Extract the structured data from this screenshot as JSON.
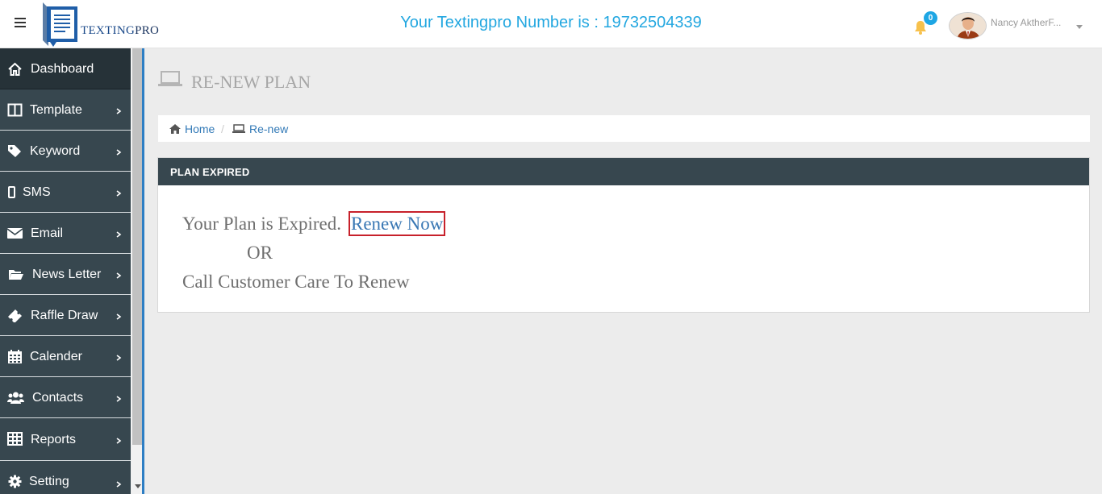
{
  "header": {
    "logo_text_main": "TEXTING",
    "logo_text_pro": "PRO",
    "title": "Your Textingpro Number is : 19732504339",
    "notification_count": "0",
    "user_name": "Nancy AktherF..."
  },
  "sidebar": {
    "items": [
      {
        "label": "Dashboard",
        "icon": "home-icon",
        "active": true
      },
      {
        "label": "Template",
        "icon": "columns-icon"
      },
      {
        "label": "Keyword",
        "icon": "tag-icon"
      },
      {
        "label": "SMS",
        "icon": "mobile-icon"
      },
      {
        "label": "Email",
        "icon": "envelope-icon"
      },
      {
        "label": "News Letter",
        "icon": "folder-open-icon"
      },
      {
        "label": "Raffle Draw",
        "icon": "ticket-icon"
      },
      {
        "label": "Calender",
        "icon": "calendar-icon"
      },
      {
        "label": "Contacts",
        "icon": "users-icon"
      },
      {
        "label": "Reports",
        "icon": "table-icon"
      },
      {
        "label": "Setting",
        "icon": "gear-icon"
      }
    ]
  },
  "page": {
    "title": "RE-NEW PLAN",
    "breadcrumb_home": "Home",
    "breadcrumb_current": "Re-new"
  },
  "panel": {
    "heading": "PLAN EXPIRED",
    "message": "Your Plan is Expired.",
    "renew_link": "Renew Now",
    "or_text": "OR",
    "call_text": "Call Customer Care To Renew"
  },
  "colors": {
    "accent": "#23a7e0",
    "sidebar_bg": "#37474f",
    "sidebar_active": "#263238",
    "link": "#337ab7",
    "highlight_border": "#c7212b",
    "bell": "#f7c14c"
  }
}
